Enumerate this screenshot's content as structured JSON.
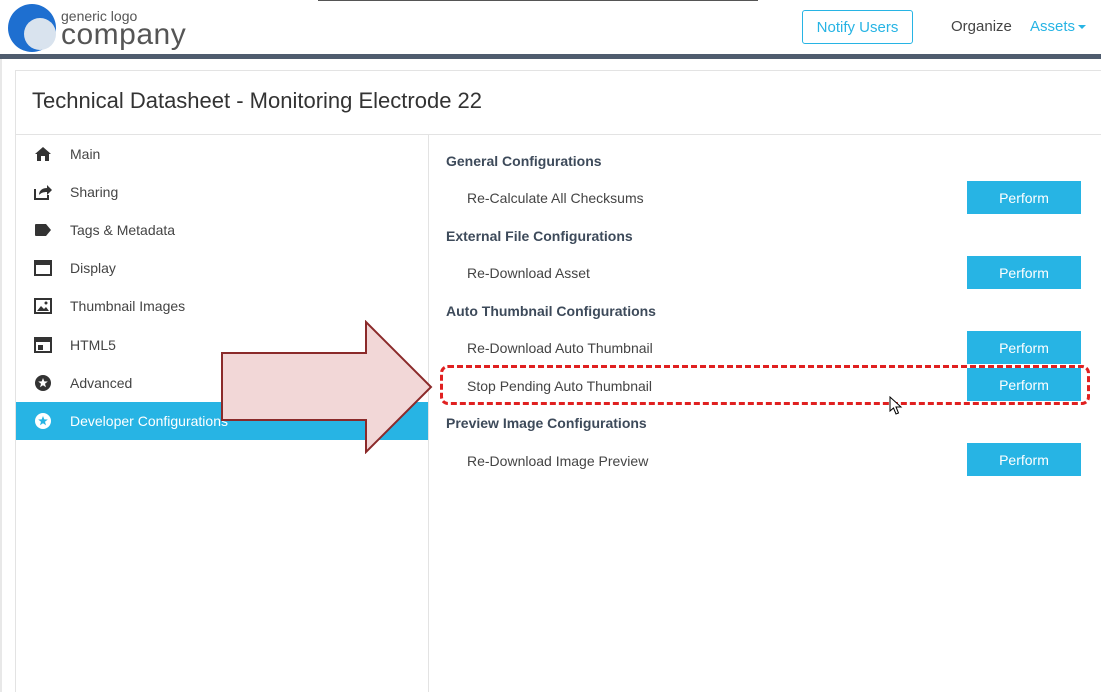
{
  "header": {
    "logo_small": "generic logo",
    "logo_big": "company",
    "notify_label": "Notify Users",
    "organize_label": "Organize",
    "assets_label": "Assets"
  },
  "page": {
    "title": "Technical Datasheet - Monitoring Electrode 22"
  },
  "sidebar": {
    "items": [
      {
        "label": "Main",
        "icon": "home-icon"
      },
      {
        "label": "Sharing",
        "icon": "share-icon"
      },
      {
        "label": "Tags & Metadata",
        "icon": "tag-icon"
      },
      {
        "label": "Display",
        "icon": "window-icon"
      },
      {
        "label": "Thumbnail Images",
        "icon": "image-icon"
      },
      {
        "label": "HTML5",
        "icon": "html5-icon"
      },
      {
        "label": "Advanced",
        "icon": "star-circle-icon"
      },
      {
        "label": "Developer Configurations",
        "icon": "star-circle-icon",
        "active": true
      }
    ]
  },
  "config": {
    "sections": [
      {
        "title": "General Configurations",
        "rows": [
          {
            "label": "Re-Calculate All Checksums",
            "button": "Perform"
          }
        ]
      },
      {
        "title": "External File Configurations",
        "rows": [
          {
            "label": "Re-Download Asset",
            "button": "Perform"
          }
        ]
      },
      {
        "title": "Auto Thumbnail Configurations",
        "rows": [
          {
            "label": "Re-Download Auto Thumbnail",
            "button": "Perform"
          },
          {
            "label": "Stop Pending Auto Thumbnail",
            "button": "Perform",
            "highlighted": true
          }
        ]
      },
      {
        "title": "Preview Image Configurations",
        "rows": [
          {
            "label": "Re-Download Image Preview",
            "button": "Perform"
          }
        ]
      }
    ]
  },
  "colors": {
    "accent": "#27b4e4",
    "highlight": "#e02020",
    "arrow_fill": "#f2d7d7",
    "arrow_stroke": "#8b2a2a"
  }
}
